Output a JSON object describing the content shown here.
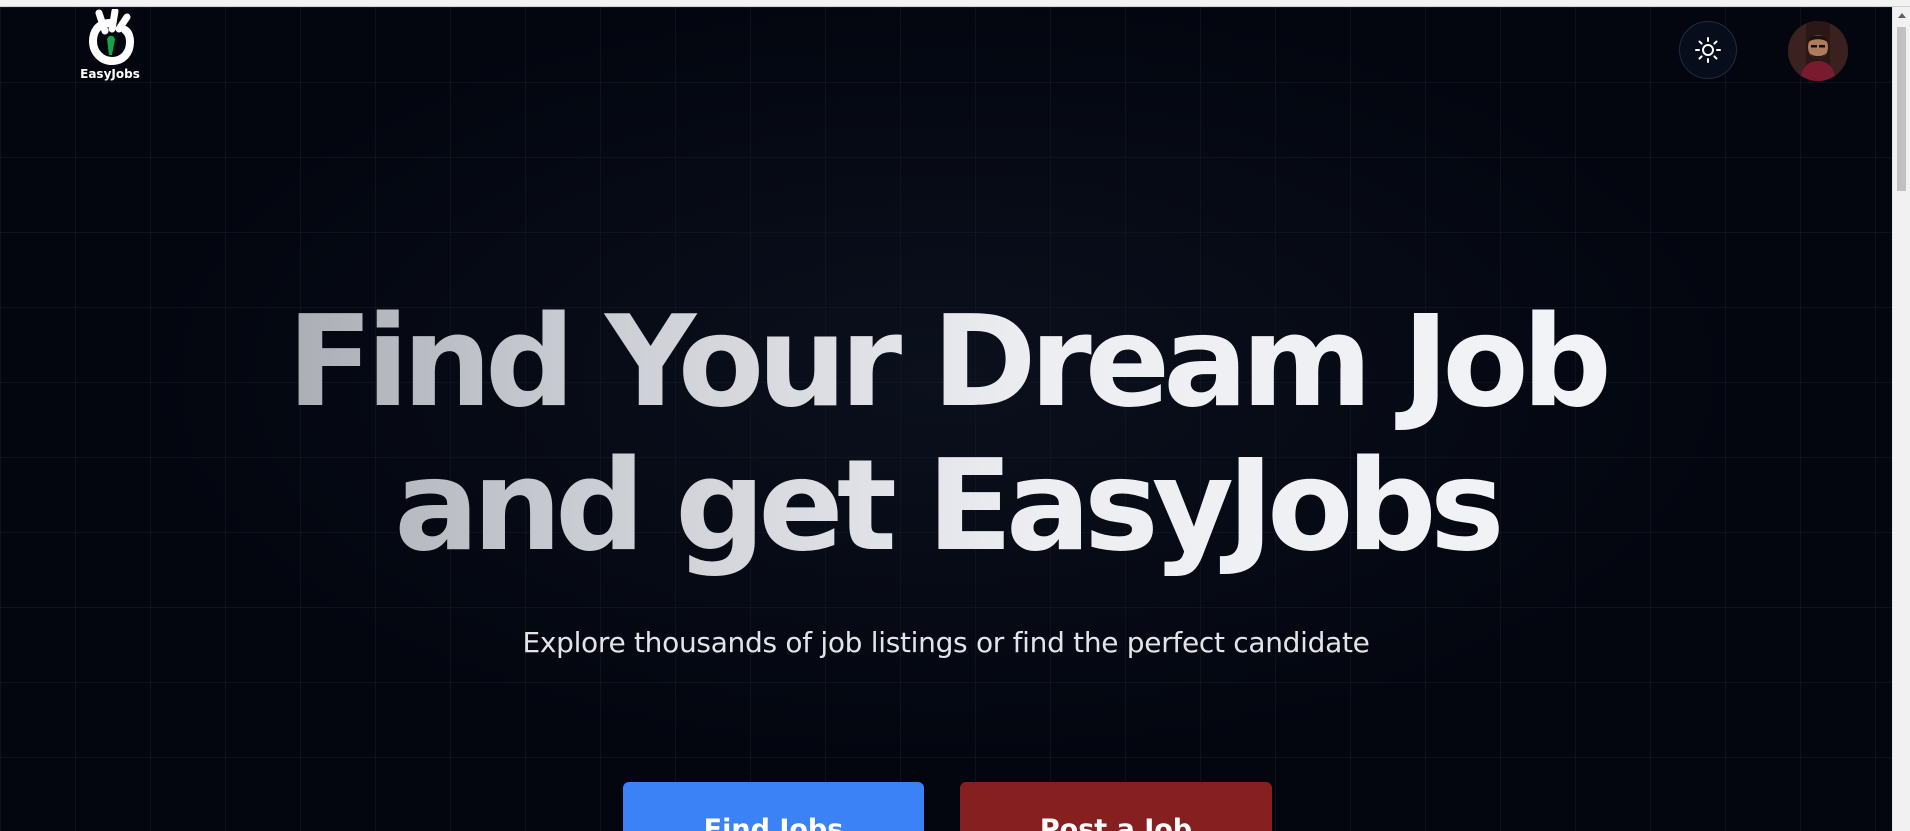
{
  "header": {
    "logo_text": "EasyJobs",
    "logo_icon": "ok-hand-icon",
    "theme_toggle_icon": "sun-icon",
    "avatar_icon": "user-avatar"
  },
  "hero": {
    "title_line1": "Find Your Dream Job",
    "title_line2": "and get EasyJobs",
    "subtitle": "Explore thousands of job listings or find the perfect candidate"
  },
  "actions": {
    "find_jobs_label": "Find Jobs",
    "post_job_label": "Post a Job"
  },
  "colors": {
    "background": "#03060f",
    "find_jobs_button": "#3b82f6",
    "post_job_button": "#861f1f",
    "logo_accent": "#16a34a"
  }
}
